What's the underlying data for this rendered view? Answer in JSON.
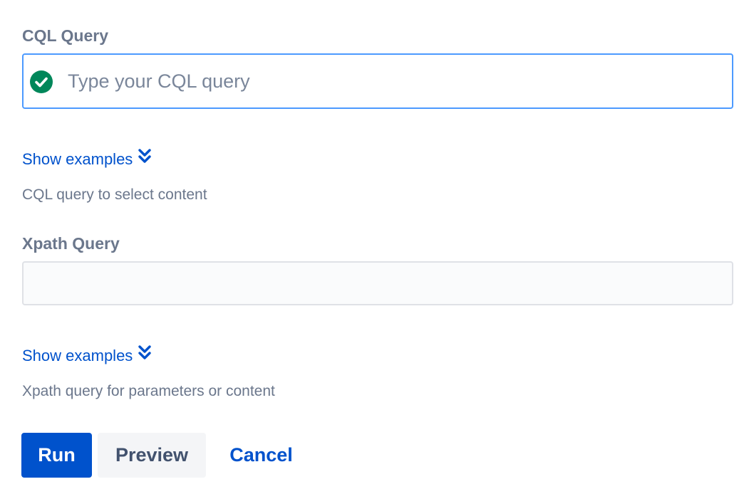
{
  "cql": {
    "label": "CQL Query",
    "placeholder": "Type your CQL query",
    "value": "",
    "valid_icon": "check-circle-icon",
    "valid_color": "#00875a",
    "show_examples": "Show examples",
    "helper": "CQL query to select content"
  },
  "xpath": {
    "label": "Xpath Query",
    "value": "",
    "show_examples": "Show examples",
    "helper": "Xpath query for parameters or content"
  },
  "actions": {
    "run": "Run",
    "preview": "Preview",
    "cancel": "Cancel"
  },
  "colors": {
    "primary": "#0052cc",
    "focus_border": "#4c9aff",
    "label": "#6b778c",
    "subtle_bg": "#f4f5f7"
  }
}
